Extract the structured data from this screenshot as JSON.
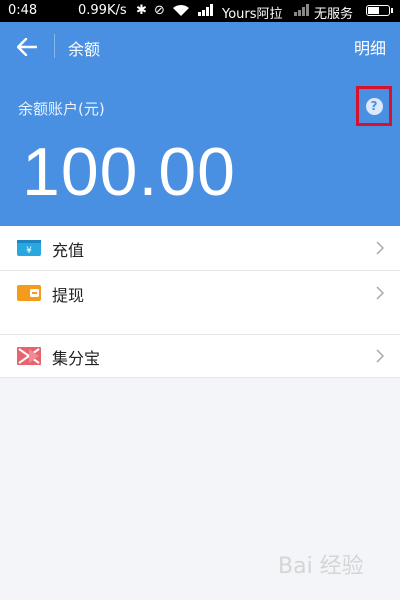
{
  "status_bar": {
    "time": "0:48",
    "speed": "0.99K/s",
    "bt_icon": "bluetooth-icon",
    "alarm_icon": "alarm-off-icon",
    "carrier1": "Yours阿拉",
    "carrier2": "无服务"
  },
  "header": {
    "title": "余额",
    "detail": "明细",
    "balance_label": "余额账户(元)",
    "balance_value": "100.00",
    "help_symbol": "?",
    "accent": "#4a90e2"
  },
  "menu": {
    "items": [
      {
        "label": "充值",
        "icon": "recharge-card-icon"
      },
      {
        "label": "提现",
        "icon": "wallet-icon"
      }
    ]
  },
  "menu2": {
    "item": {
      "label": "集分宝",
      "icon": "jifenbao-icon"
    }
  },
  "watermark": {
    "text": "Bai 经验"
  }
}
